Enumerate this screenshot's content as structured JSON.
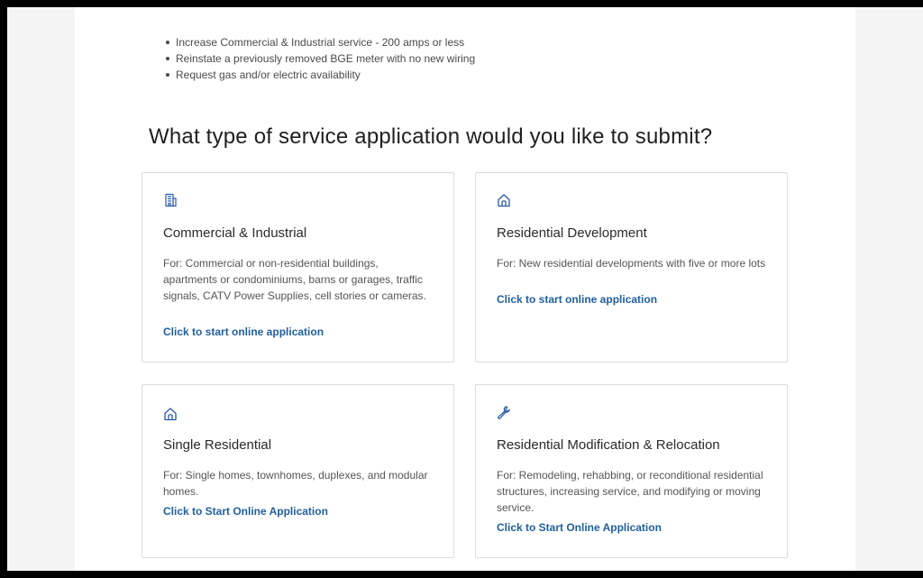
{
  "bullets": [
    "Increase Commercial & Industrial service - 200 amps or less",
    "Reinstate a previously removed BGE meter with no new wiring",
    "Request gas and/or electric availability"
  ],
  "heading": "What type of service application would you like to submit?",
  "cards": [
    {
      "icon": "building-icon",
      "title": "Commercial & Industrial",
      "description": "For: Commercial or non-residential buildings, apartments or condominiums, barns or garages, traffic signals, CATV Power Supplies, cell stories or cameras.",
      "link": "Click to start online application"
    },
    {
      "icon": "house-icon",
      "title": "Residential Development",
      "description": "For: New residential developments with five or more lots",
      "link": "Click to start online application"
    },
    {
      "icon": "house-icon",
      "title": "Single Residential",
      "description": "For: Single homes, townhomes, duplexes, and modular homes.",
      "link": "Click to Start Online Application"
    },
    {
      "icon": "wrench-icon",
      "title": "Residential Modification & Relocation",
      "description": "For: Remodeling, rehabbing, or reconditional residential structures, increasing service, and modifying or moving service.",
      "link": "Click to Start Online Application"
    }
  ],
  "colors": {
    "link": "#1f5f9e",
    "icon": "#2b5aa8",
    "card_border": "#dcdcdc"
  }
}
